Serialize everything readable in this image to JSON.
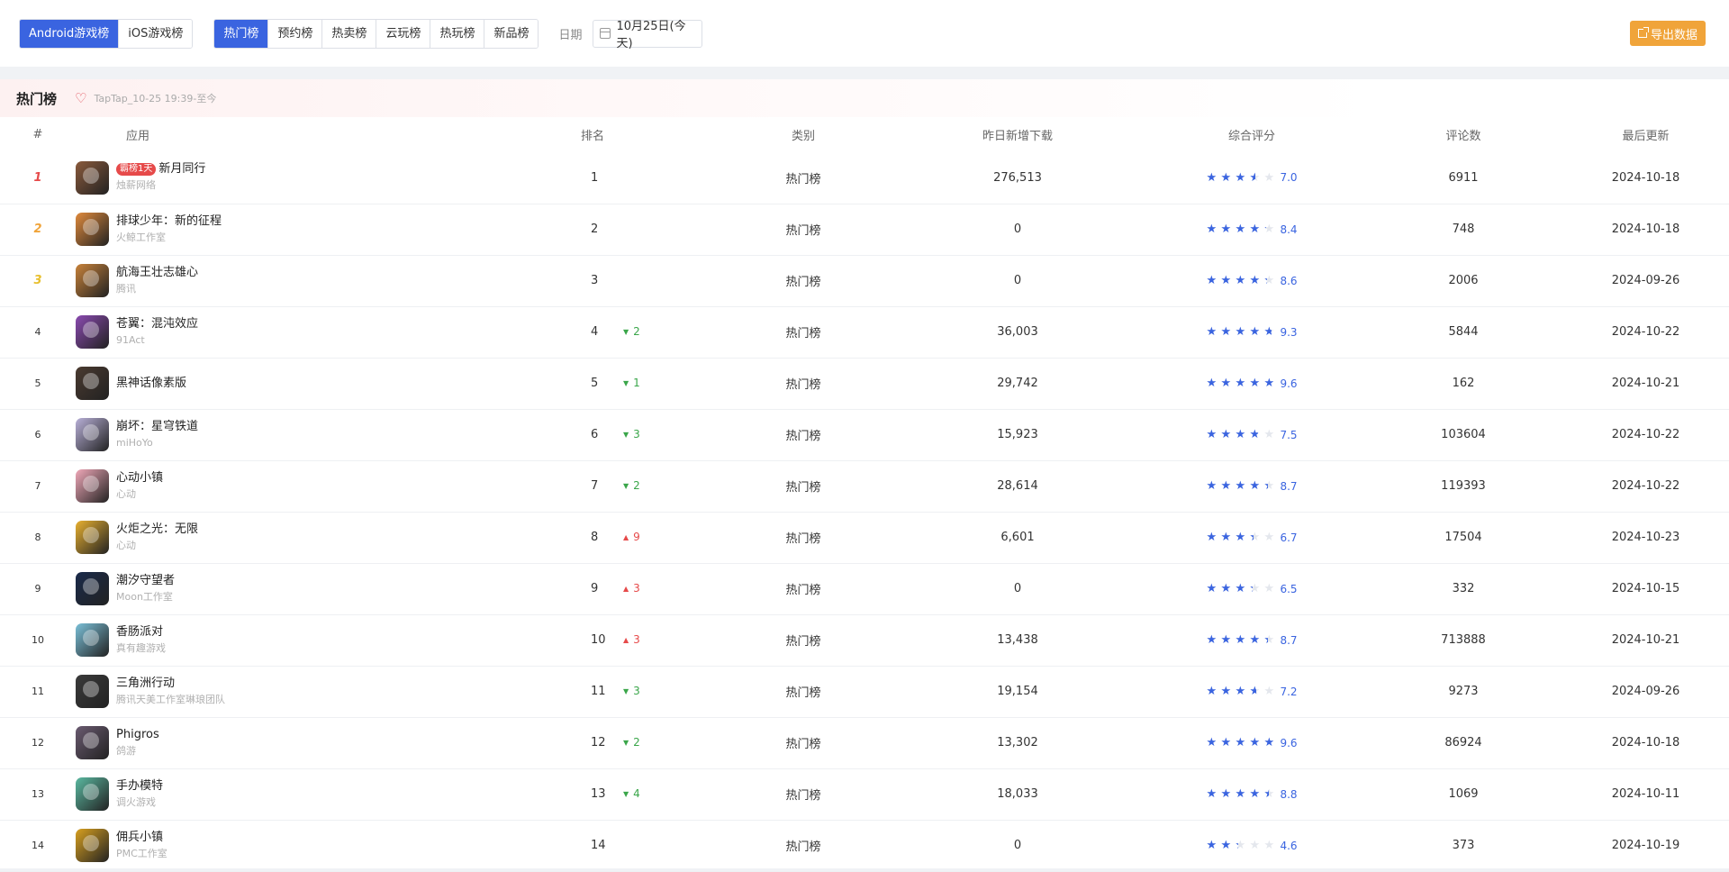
{
  "platform_tabs": [
    {
      "label": "Android游戏榜",
      "active": true
    },
    {
      "label": "iOS游戏榜",
      "active": false
    }
  ],
  "chart_tabs": [
    {
      "label": "热门榜",
      "active": true
    },
    {
      "label": "预约榜",
      "active": false
    },
    {
      "label": "热卖榜",
      "active": false
    },
    {
      "label": "云玩榜",
      "active": false
    },
    {
      "label": "热玩榜",
      "active": false
    },
    {
      "label": "新品榜",
      "active": false
    }
  ],
  "date": {
    "label": "日期",
    "value": "10月25日(今天)"
  },
  "export_label": "导出数据",
  "panel": {
    "title": "热门榜",
    "subtitle": "TapTap_10-25 19:39-至今"
  },
  "columns": {
    "index": "#",
    "app": "应用",
    "rank": "排名",
    "category": "类别",
    "downloads": "昨日新增下载",
    "rating": "综合评分",
    "reviews": "评论数",
    "updated": "最后更新"
  },
  "colors": {
    "accent": "#3a64e0",
    "export": "#f0a43a",
    "down": "#3aa64a",
    "up": "#e64a4a"
  },
  "rows": [
    {
      "index": "1",
      "name": "新月同行",
      "badge": "霸榜1天",
      "dev": "烛薪网络",
      "rank": "1",
      "delta": "",
      "dir": "",
      "category": "热门榜",
      "downloads": "276,513",
      "rating": 7.0,
      "score": "7.0",
      "reviews": "6911",
      "updated": "2024-10-18",
      "icon_color": "#8a5a3c"
    },
    {
      "index": "2",
      "name": "排球少年：新的征程",
      "badge": "",
      "dev": "火鲸工作室",
      "rank": "2",
      "delta": "",
      "dir": "",
      "category": "热门榜",
      "downloads": "0",
      "rating": 8.4,
      "score": "8.4",
      "reviews": "748",
      "updated": "2024-10-18",
      "icon_color": "#e08a3c"
    },
    {
      "index": "3",
      "name": "航海王壮志雄心",
      "badge": "",
      "dev": "腾讯",
      "rank": "3",
      "delta": "",
      "dir": "",
      "category": "热门榜",
      "downloads": "0",
      "rating": 8.6,
      "score": "8.6",
      "reviews": "2006",
      "updated": "2024-09-26",
      "icon_color": "#c8823a"
    },
    {
      "index": "4",
      "name": "苍翼：混沌效应",
      "badge": "",
      "dev": "91Act",
      "rank": "4",
      "delta": "2",
      "dir": "down",
      "category": "热门榜",
      "downloads": "36,003",
      "rating": 9.3,
      "score": "9.3",
      "reviews": "5844",
      "updated": "2024-10-22",
      "icon_color": "#8a4ab0"
    },
    {
      "index": "5",
      "name": "黑神话像素版",
      "badge": "",
      "dev": "",
      "rank": "5",
      "delta": "1",
      "dir": "down",
      "category": "热门榜",
      "downloads": "29,742",
      "rating": 9.6,
      "score": "9.6",
      "reviews": "162",
      "updated": "2024-10-21",
      "icon_color": "#4a3a30"
    },
    {
      "index": "6",
      "name": "崩坏：星穹铁道",
      "badge": "",
      "dev": "miHoYo",
      "rank": "6",
      "delta": "3",
      "dir": "down",
      "category": "热门榜",
      "downloads": "15,923",
      "rating": 7.5,
      "score": "7.5",
      "reviews": "103604",
      "updated": "2024-10-22",
      "icon_color": "#b8b0d8"
    },
    {
      "index": "7",
      "name": "心动小镇",
      "badge": "",
      "dev": "心动",
      "rank": "7",
      "delta": "2",
      "dir": "down",
      "category": "热门榜",
      "downloads": "28,614",
      "rating": 8.7,
      "score": "8.7",
      "reviews": "119393",
      "updated": "2024-10-22",
      "icon_color": "#f0a8b8"
    },
    {
      "index": "8",
      "name": "火炬之光：无限",
      "badge": "",
      "dev": "心动",
      "rank": "8",
      "delta": "9",
      "dir": "up",
      "category": "热门榜",
      "downloads": "6,601",
      "rating": 6.7,
      "score": "6.7",
      "reviews": "17504",
      "updated": "2024-10-23",
      "icon_color": "#e8b030"
    },
    {
      "index": "9",
      "name": "潮汐守望者",
      "badge": "",
      "dev": "Moon工作室",
      "rank": "9",
      "delta": "3",
      "dir": "up",
      "category": "热门榜",
      "downloads": "0",
      "rating": 6.5,
      "score": "6.5",
      "reviews": "332",
      "updated": "2024-10-15",
      "icon_color": "#1a2a4a"
    },
    {
      "index": "10",
      "name": "香肠派对",
      "badge": "",
      "dev": "真有趣游戏",
      "rank": "10",
      "delta": "3",
      "dir": "up",
      "category": "热门榜",
      "downloads": "13,438",
      "rating": 8.7,
      "score": "8.7",
      "reviews": "713888",
      "updated": "2024-10-21",
      "icon_color": "#7ac0d8"
    },
    {
      "index": "11",
      "name": "三角洲行动",
      "badge": "",
      "dev": "腾讯天美工作室琳琅团队",
      "rank": "11",
      "delta": "3",
      "dir": "down",
      "category": "热门榜",
      "downloads": "19,154",
      "rating": 7.2,
      "score": "7.2",
      "reviews": "9273",
      "updated": "2024-09-26",
      "icon_color": "#3a3a3a"
    },
    {
      "index": "12",
      "name": "Phigros",
      "badge": "",
      "dev": "鸽游",
      "rank": "12",
      "delta": "2",
      "dir": "down",
      "category": "热门榜",
      "downloads": "13,302",
      "rating": 9.6,
      "score": "9.6",
      "reviews": "86924",
      "updated": "2024-10-18",
      "icon_color": "#6a5a70"
    },
    {
      "index": "13",
      "name": "手办模特",
      "badge": "",
      "dev": "调火游戏",
      "rank": "13",
      "delta": "4",
      "dir": "down",
      "category": "热门榜",
      "downloads": "18,033",
      "rating": 8.8,
      "score": "8.8",
      "reviews": "1069",
      "updated": "2024-10-11",
      "icon_color": "#5ab8a0"
    },
    {
      "index": "14",
      "name": "佣兵小镇",
      "badge": "",
      "dev": "PMC工作室",
      "rank": "14",
      "delta": "",
      "dir": "",
      "category": "热门榜",
      "downloads": "0",
      "rating": 4.6,
      "score": "4.6",
      "reviews": "373",
      "updated": "2024-10-19",
      "icon_color": "#d8a020"
    }
  ]
}
